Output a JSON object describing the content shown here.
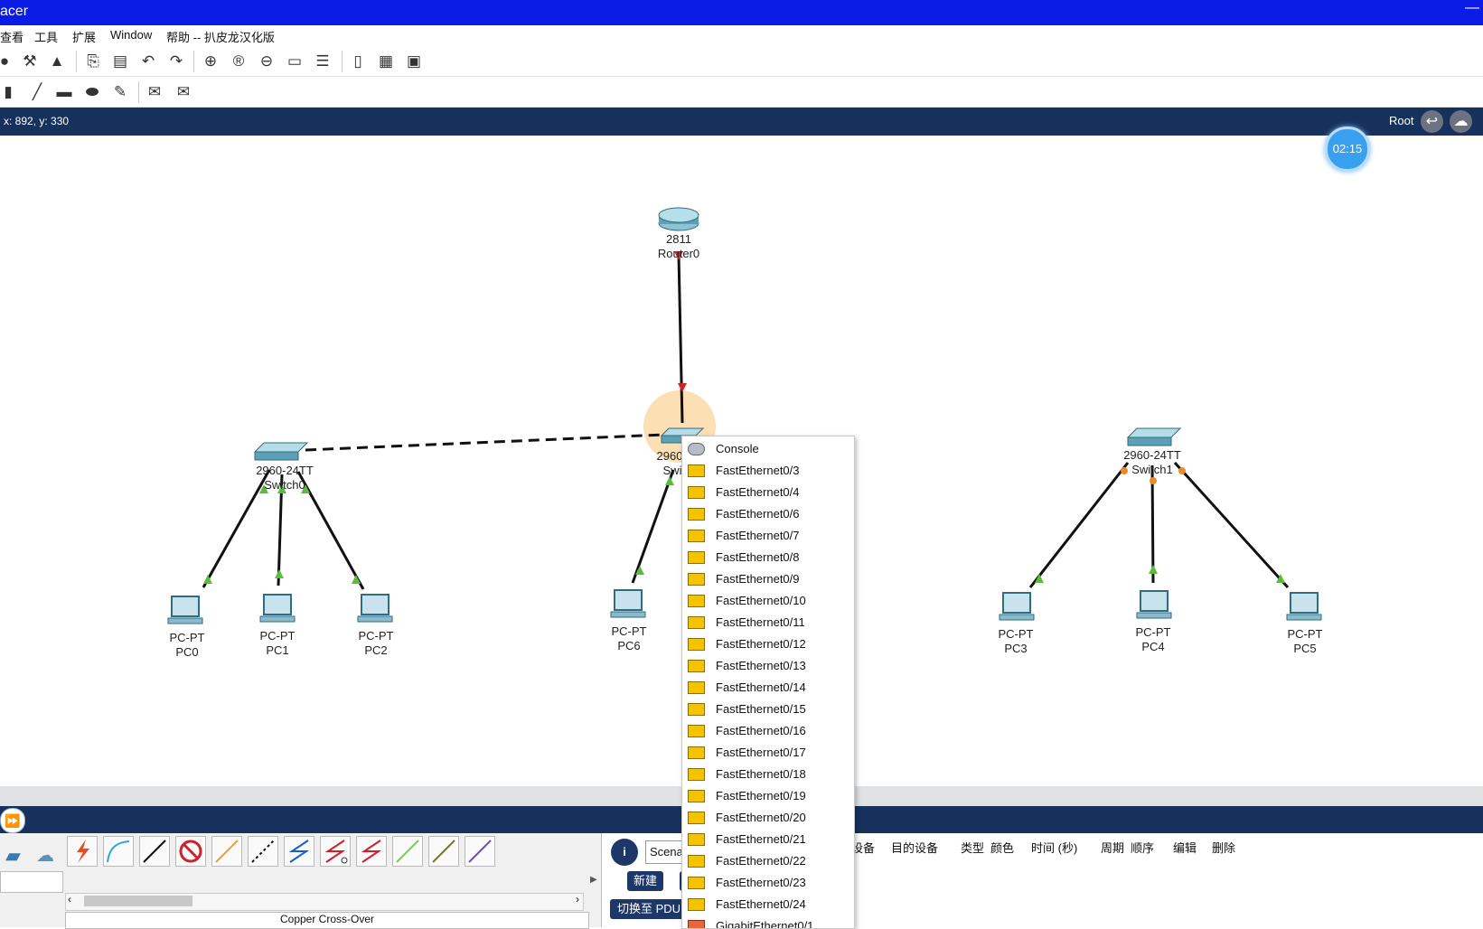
{
  "window": {
    "title": "acer"
  },
  "menu": {
    "items": [
      "查看",
      "工具",
      "扩展",
      "Window",
      "帮助 -- 扒皮龙汉化版"
    ]
  },
  "status": {
    "coords": "x: 892, y: 330",
    "mode": "Root"
  },
  "timer": "02:15",
  "devices": [
    {
      "model": "2811",
      "name": "Router0"
    },
    {
      "model": "2960-24TT",
      "name": "Switch0"
    },
    {
      "model": "2960",
      "name": "Swi"
    },
    {
      "model": "2960-24TT",
      "name": "Switch1"
    },
    {
      "model": "PC-PT",
      "name": "PC0"
    },
    {
      "model": "PC-PT",
      "name": "PC1"
    },
    {
      "model": "PC-PT",
      "name": "PC2"
    },
    {
      "model": "PC-PT",
      "name": "PC6"
    },
    {
      "model": "PC-PT",
      "name": "PC3"
    },
    {
      "model": "PC-PT",
      "name": "PC4"
    },
    {
      "model": "PC-PT",
      "name": "PC5"
    }
  ],
  "port_menu": {
    "items": [
      "Console",
      "FastEthernet0/3",
      "FastEthernet0/4",
      "FastEthernet0/6",
      "FastEthernet0/7",
      "FastEthernet0/8",
      "FastEthernet0/9",
      "FastEthernet0/10",
      "FastEthernet0/11",
      "FastEthernet0/12",
      "FastEthernet0/13",
      "FastEthernet0/14",
      "FastEthernet0/15",
      "FastEthernet0/16",
      "FastEthernet0/17",
      "FastEthernet0/18",
      "FastEthernet0/19",
      "FastEthernet0/20",
      "FastEthernet0/21",
      "FastEthernet0/22",
      "FastEthernet0/23",
      "FastEthernet0/24",
      "GigabitEthernet0/1"
    ]
  },
  "bottom": {
    "cable_name": "Copper Cross-Over",
    "scenario": "Scena",
    "new_button": "新建",
    "switch_pdu": "切换至 PDU",
    "pdu_columns": [
      "设备",
      "目的设备",
      "类型",
      "颜色",
      "时间 (秒)",
      "周期",
      "顺序",
      "编辑",
      "删除"
    ]
  }
}
